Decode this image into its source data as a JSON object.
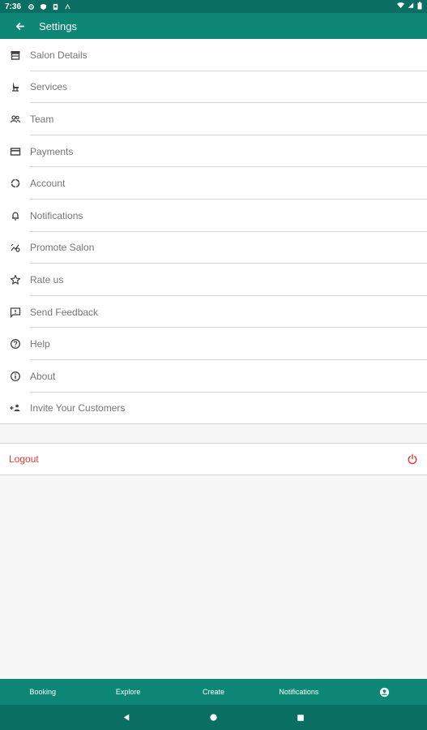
{
  "status_bar": {
    "time": "7:36"
  },
  "app_bar": {
    "title": "Settings"
  },
  "settings": {
    "items": [
      {
        "label": "Salon Details",
        "icon": "store-icon"
      },
      {
        "label": "Services",
        "icon": "salon-chair-icon"
      },
      {
        "label": "Team",
        "icon": "team-icon"
      },
      {
        "label": "Payments",
        "icon": "credit-card-icon"
      },
      {
        "label": "Account",
        "icon": "account-icon"
      },
      {
        "label": "Notifications",
        "icon": "bell-icon"
      },
      {
        "label": "Promote Salon",
        "icon": "promote-icon"
      },
      {
        "label": "Rate us",
        "icon": "star-icon"
      },
      {
        "label": "Send Feedback",
        "icon": "feedback-icon"
      },
      {
        "label": "Help",
        "icon": "help-icon"
      },
      {
        "label": "About",
        "icon": "info-icon"
      },
      {
        "label": "Invite Your Customers",
        "icon": "invite-icon"
      }
    ]
  },
  "logout": {
    "label": "Logout"
  },
  "bottom_nav": {
    "tabs": [
      "Booking",
      "Explore",
      "Create",
      "Notifications"
    ]
  },
  "colors": {
    "primary": "#0e8676",
    "status": "#0a6e63",
    "logout": "#e53935",
    "text": "#757575"
  }
}
